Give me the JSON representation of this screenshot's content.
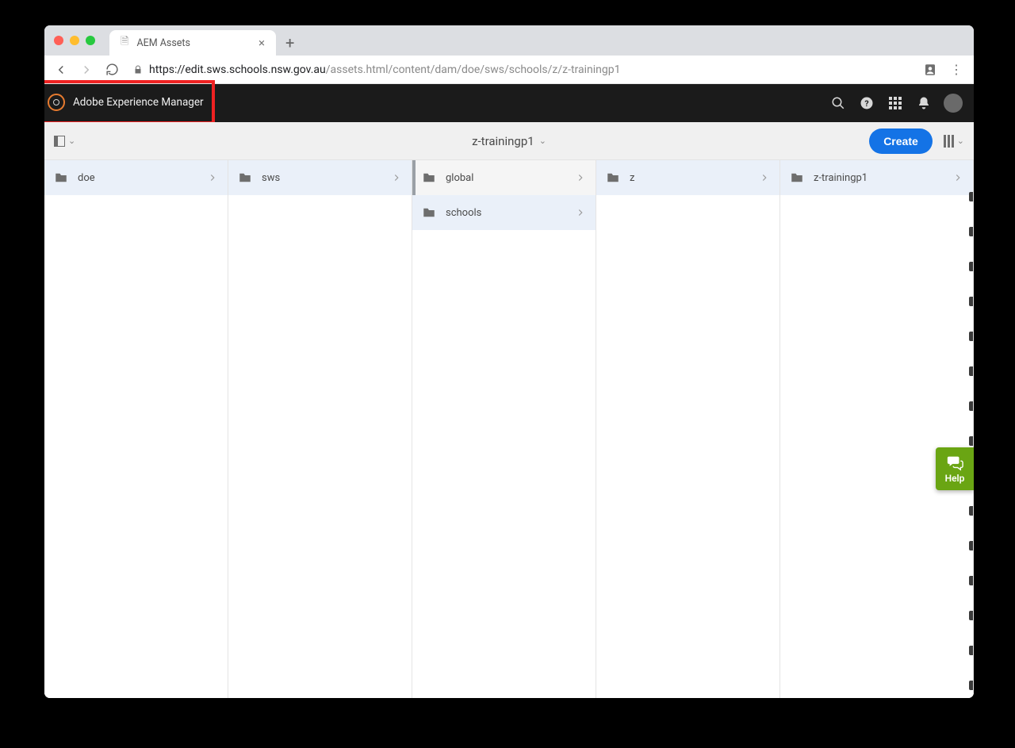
{
  "browser": {
    "tab_title": "AEM Assets",
    "url_host": "https://edit.sws.schools.nsw.gov.au",
    "url_path": "/assets.html/content/dam/doe/sws/schools/z/z-trainingp1"
  },
  "header": {
    "brand": "Adobe Experience Manager"
  },
  "toolbar": {
    "current_folder": "z-trainingp1",
    "create_label": "Create"
  },
  "columns": [
    {
      "items": [
        {
          "label": "doe",
          "selected": true
        }
      ]
    },
    {
      "items": [
        {
          "label": "sws",
          "selected": true
        }
      ]
    },
    {
      "items": [
        {
          "label": "global",
          "selected": false
        },
        {
          "label": "schools",
          "selected": true
        }
      ],
      "highlight": true
    },
    {
      "items": [
        {
          "label": "z",
          "selected": true
        }
      ]
    },
    {
      "items": [
        {
          "label": "z-trainingp1",
          "selected": true
        }
      ]
    }
  ],
  "help": {
    "label": "Help"
  }
}
